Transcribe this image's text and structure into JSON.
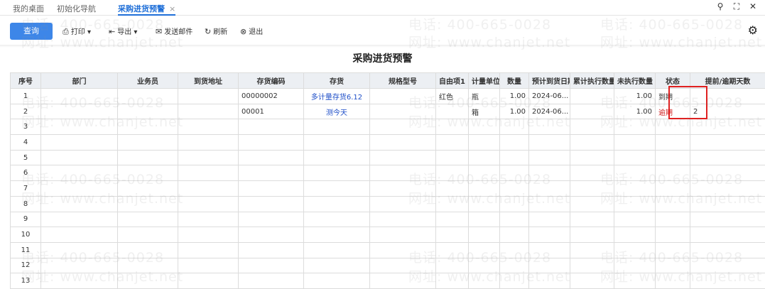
{
  "tabs": [
    {
      "label": "我的桌面"
    },
    {
      "label": "初始化导航"
    },
    {
      "label": "采购进货预警",
      "close": "×"
    }
  ],
  "window_controls": {
    "search": "⚲",
    "maximize": "⛶",
    "close": "✕"
  },
  "toolbar": {
    "query_label": "查询",
    "print_label": "打印",
    "export_label": "导出",
    "email_label": "发送邮件",
    "refresh_label": "刷新",
    "exit_label": "退出"
  },
  "report_title": "采购进货预警",
  "table": {
    "columns": [
      "序号",
      "部门",
      "业务员",
      "到货地址",
      "存货编码",
      "存货",
      "规格型号",
      "自由项1",
      "计量单位",
      "数量",
      "预计到货日期",
      "累计执行数量",
      "未执行数量",
      "状态",
      "提前/逾期天数"
    ],
    "rows": [
      {
        "seq": "1",
        "dept": "",
        "staff": "",
        "addr": "",
        "code": "00000002",
        "item": "多计量存货6.12",
        "spec": "",
        "free1": "红色",
        "unit": "瓶",
        "qty": "1.00",
        "date": "2024-06...",
        "cum": "",
        "remain": "1.00",
        "status": "到期",
        "days": ""
      },
      {
        "seq": "2",
        "dept": "",
        "staff": "",
        "addr": "",
        "code": "00001",
        "item": "测今天",
        "spec": "",
        "free1": "",
        "unit": "箱",
        "qty": "1.00",
        "date": "2024-06...",
        "cum": "",
        "remain": "1.00",
        "status": "逾期",
        "days": "2"
      },
      {
        "seq": "3"
      },
      {
        "seq": "4"
      },
      {
        "seq": "5"
      },
      {
        "seq": "6"
      },
      {
        "seq": "7"
      },
      {
        "seq": "8"
      },
      {
        "seq": "9"
      },
      {
        "seq": "10"
      },
      {
        "seq": "11"
      },
      {
        "seq": "12"
      },
      {
        "seq": "13"
      }
    ]
  },
  "watermark": {
    "phone": "电话: 400-665-0028",
    "site": "网址: www.chanjet.net"
  },
  "colors": {
    "accent": "#3d86e8",
    "overdue": "#d02020",
    "highlight_box": "#e02020"
  }
}
